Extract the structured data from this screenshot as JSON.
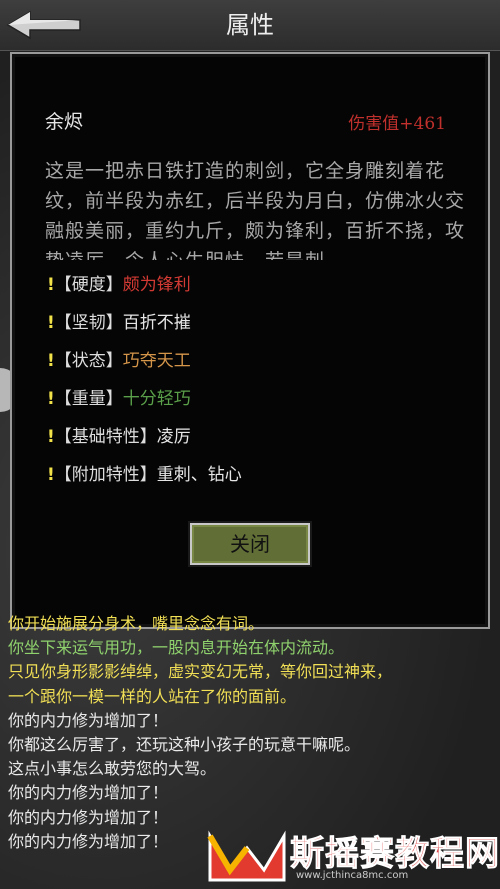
{
  "header": {
    "title": "属性"
  },
  "item": {
    "name": "余烬",
    "damage": "伤害值+461",
    "description": "这是一把赤日铁打造的刺剑，它全身雕刻着花纹，前半段为赤红，后半段为月白，仿佛冰火交融般美丽，重约九斤，颇为锋利，百折不挠，攻势凌厉，令人心生胆怯，若是刺"
  },
  "properties": [
    {
      "bang": "!",
      "label": "【硬度】",
      "value": "颇为锋利",
      "color": "#d43a34"
    },
    {
      "bang": "!",
      "label": "【坚韧】",
      "value": "百折不摧",
      "color": "#e6e6e6"
    },
    {
      "bang": "!",
      "label": "【状态】",
      "value": "巧夺天工",
      "color": "#d6964a"
    },
    {
      "bang": "!",
      "label": "【重量】",
      "value": "十分轻巧",
      "color": "#5aa04a"
    },
    {
      "bang": "!",
      "label": "【基础特性】",
      "value": "凌厉",
      "color": "#e6e6e6"
    },
    {
      "bang": "!",
      "label": "【附加特性】",
      "value": "重刺、钻心",
      "color": "#e6e6e6"
    }
  ],
  "close_button": "关闭",
  "log": [
    {
      "text": "你开始施展分身术，嘴里念念有词。",
      "color": "yellow"
    },
    {
      "text": "你坐下来运气用功，一股内息开始在体内流动。",
      "color": "green"
    },
    {
      "text": "只见你身形影影绰绰，虚实变幻无常，等你回过神来，",
      "color": "yellow"
    },
    {
      "text": "一个跟你一模一样的人站在了你的面前。",
      "color": "yellow"
    },
    {
      "text": "你的内力修为增加了！",
      "color": "white"
    },
    {
      "text": "你都这么厉害了，还玩这种小孩子的玩意干嘛呢。",
      "color": "white"
    },
    {
      "text": "这点小事怎么敢劳您的大驾。",
      "color": "white"
    },
    {
      "text": "你的内力修为增加了！",
      "color": "white"
    },
    {
      "text": "你的内力修为增加了！",
      "color": "white"
    },
    {
      "text": "你的内力修为增加了！",
      "color": "white"
    }
  ],
  "watermark": {
    "text": "斯摇赛教程网",
    "url": "www.jcthinca8mc.com"
  }
}
